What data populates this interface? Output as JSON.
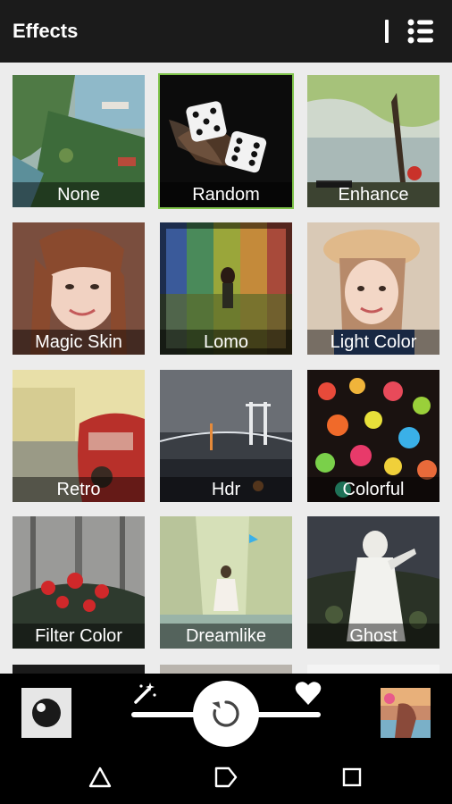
{
  "header": {
    "title": "Effects"
  },
  "effects": [
    {
      "label": "None",
      "selected": false
    },
    {
      "label": "Random",
      "selected": true
    },
    {
      "label": "Enhance",
      "selected": false
    },
    {
      "label": "Magic Skin",
      "selected": false
    },
    {
      "label": "Lomo",
      "selected": false
    },
    {
      "label": "Light Color",
      "selected": false
    },
    {
      "label": "Retro",
      "selected": false
    },
    {
      "label": "Hdr",
      "selected": false
    },
    {
      "label": "Colorful",
      "selected": false
    },
    {
      "label": "Filter Color",
      "selected": false
    },
    {
      "label": "Dreamlike",
      "selected": false
    },
    {
      "label": "Ghost",
      "selected": false
    }
  ],
  "toolbar": {
    "icons": [
      "face-icon",
      "magic-wand-icon",
      "reset-icon",
      "heart-icon",
      "photo-thumbnail"
    ],
    "slider_level": 0.5
  },
  "navigation": {
    "icons": [
      "back-icon",
      "home-icon",
      "recents-icon"
    ]
  },
  "colors": {
    "accent": "#7fc34a",
    "topbar": "#1b1b1b",
    "grid_bg": "#ececec"
  }
}
